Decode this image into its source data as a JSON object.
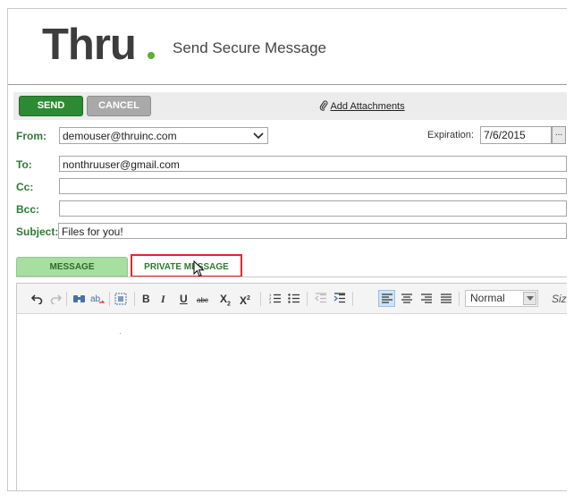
{
  "header": {
    "logo": "Thru",
    "title": "Send Secure Message"
  },
  "toolbar": {
    "send_label": "SEND",
    "cancel_label": "CANCEL",
    "attach_label": "Add Attachments",
    "attach_icon": "paperclip-icon"
  },
  "form": {
    "from_label": "From:",
    "from_value": "demouser@thruinc.com",
    "expiration_label": "Expiration:",
    "expiration_value": "7/6/2015",
    "calendar_button": "...",
    "to_label": "To:",
    "to_value": "nonthruuser@gmail.com",
    "cc_label": "Cc:",
    "cc_value": "",
    "bcc_label": "Bcc:",
    "bcc_value": "",
    "subject_label": "Subject:",
    "subject_value": "Files for you!"
  },
  "tabs": {
    "message_label": "MESSAGE",
    "private_label": "PRIVATE MESSAGE"
  },
  "editor": {
    "format_value": "Normal",
    "size_label": "Size",
    "buttons": {
      "bold": "B",
      "italic": "I",
      "underline": "U",
      "strike": "abc",
      "subscript": "X",
      "superscript": "X"
    },
    "icons": [
      "undo-icon",
      "redo-icon",
      "find-icon",
      "replace-icon",
      "select-all-icon",
      "bold-icon",
      "italic-icon",
      "underline-icon",
      "strikethrough-icon",
      "subscript-icon",
      "superscript-icon",
      "numbered-list-icon",
      "bulleted-list-icon",
      "outdent-icon",
      "indent-icon",
      "align-left-icon",
      "align-center-icon",
      "align-right-icon",
      "justify-icon"
    ]
  },
  "colors": {
    "accent_green": "#2d8a34",
    "label_green": "#2d7a33",
    "tab_green": "#a7dfa0",
    "highlight_red": "#e3252f"
  }
}
